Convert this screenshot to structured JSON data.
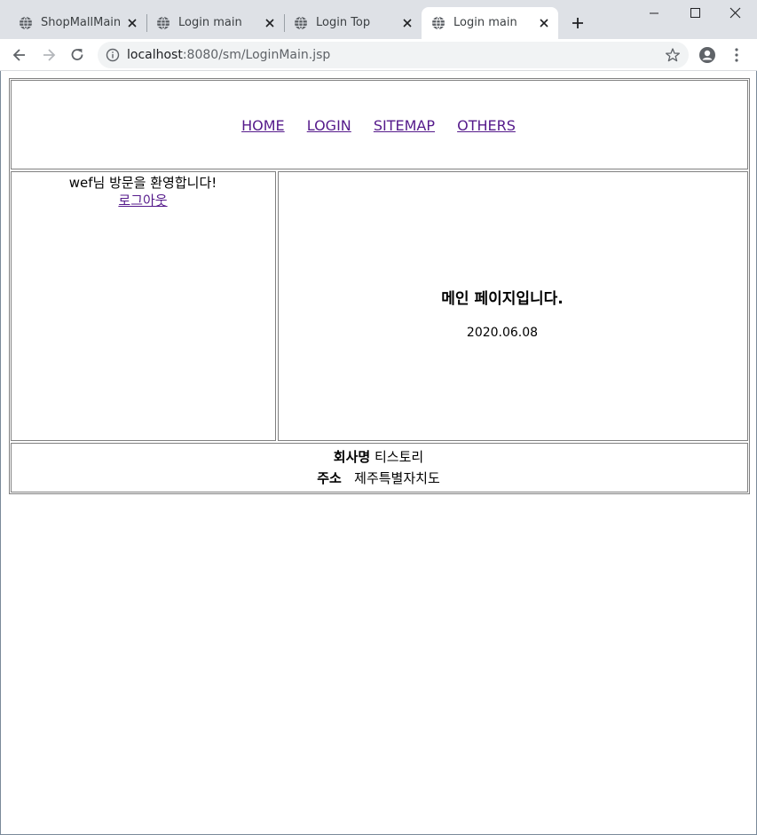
{
  "browser": {
    "tabs": [
      {
        "title": "ShopMallMain JSP",
        "active": false
      },
      {
        "title": "Login main",
        "active": false
      },
      {
        "title": "Login Top",
        "active": false
      },
      {
        "title": "Login main",
        "active": true
      }
    ],
    "address": {
      "host": "localhost",
      "rest": ":8080/sm/LoginMain.jsp"
    },
    "icons": {
      "back": "back-arrow-icon",
      "forward": "forward-arrow-icon",
      "reload": "reload-icon",
      "info": "info-icon",
      "star": "star-icon",
      "profile": "profile-icon",
      "menu": "kebab-menu-icon"
    }
  },
  "page": {
    "nav": [
      "HOME",
      "LOGIN",
      "SITEMAP",
      "OTHERS"
    ],
    "sidebar": {
      "welcome": "wef님 방문을 환영합니다!",
      "logout": "로그아웃"
    },
    "main": {
      "title": "메인 페이지입니다.",
      "date": "2020.06.08"
    },
    "footer": {
      "company_label": "회사명",
      "company_value": "티스토리",
      "address_label": "주소",
      "address_value": "제주특별자치도"
    }
  },
  "colors": {
    "link_visited": "#551a8b",
    "border": "#808080",
    "tabstrip": "#dee1e6"
  }
}
